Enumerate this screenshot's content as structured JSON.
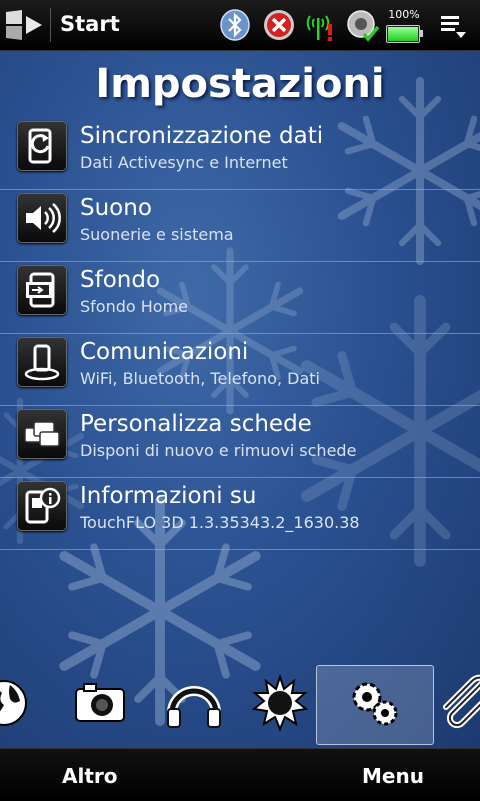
{
  "statusbar": {
    "title": "Start",
    "battery_text": "100%",
    "battery_level": 1.0,
    "icons": [
      "windows-logo-icon",
      "bluetooth-icon",
      "connection-error-icon",
      "signal-icon",
      "volume-icon",
      "battery-icon",
      "menu-icon"
    ]
  },
  "page": {
    "title": "Impostazioni"
  },
  "items": [
    {
      "title": "Sincronizzazione dati",
      "subtitle": "Dati Activesync e Internet",
      "icon": "sync-icon"
    },
    {
      "title": "Suono",
      "subtitle": "Suonerie e sistema",
      "icon": "speaker-icon"
    },
    {
      "title": "Sfondo",
      "subtitle": "Sfondo Home",
      "icon": "wallpaper-icon"
    },
    {
      "title": "Comunicazioni",
      "subtitle": "WiFi, Bluetooth, Telefono, Dati",
      "icon": "phone-wireless-icon"
    },
    {
      "title": "Personalizza schede",
      "subtitle": "Disponi di nuovo e rimuovi schede",
      "icon": "tabs-icon"
    },
    {
      "title": "Informazioni su",
      "subtitle": "TouchFLO 3D 1.3.35343.2_1630.38",
      "icon": "info-icon"
    }
  ],
  "tabs": [
    {
      "icon": "globe-icon",
      "active": false
    },
    {
      "icon": "camera-icon",
      "active": false
    },
    {
      "icon": "headphones-icon",
      "active": false
    },
    {
      "icon": "weather-icon",
      "active": false
    },
    {
      "icon": "settings-gears-icon",
      "active": true
    },
    {
      "icon": "paperclip-icon",
      "active": false
    }
  ],
  "softkeys": {
    "left": "Altro",
    "right": "Menu"
  },
  "colors": {
    "background": "#2b5191",
    "statusbar": "#000000",
    "battery": "#33cc33"
  }
}
